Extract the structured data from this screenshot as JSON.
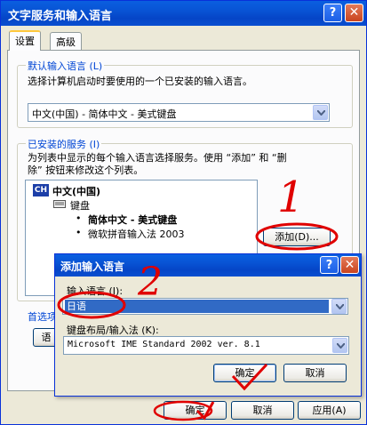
{
  "window": {
    "title": "文字服务和输入语言",
    "help_glyph": "?",
    "close_glyph": "✕"
  },
  "tabs": [
    {
      "label": "设置",
      "active": true
    },
    {
      "label": "高级",
      "active": false
    }
  ],
  "default_language": {
    "group_label": "默认输入语言 (L)",
    "description": "选择计算机启动时要使用的一个已安装的输入语言。",
    "selected": "中文(中国) - 简体中文 - 美式键盘"
  },
  "installed_services": {
    "group_label": "已安装的服务 (I)",
    "description_line1": "为列表中显示的每个输入语言选择服务。使用 “添加” 和 “删",
    "description_line2": "除” 按钮来修改这个列表。",
    "tree": {
      "lang_badge": "CH",
      "language": "中文(中国)",
      "category": "键盘",
      "items": [
        "简体中文 - 美式键盘",
        "微软拼音输入法 2003"
      ]
    },
    "add_button": "添加(D)..."
  },
  "preferences": {
    "group_label": "首选项",
    "button_partial": "语"
  },
  "dialog": {
    "title": "添加输入语言",
    "input_language_label": "输入语言 (I):",
    "input_language_value": "日语",
    "keyboard_label": "键盘布局/输入法 (K):",
    "keyboard_value": "Microsoft IME Standard 2002 ver. 8.1",
    "ok": "确定",
    "cancel": "取消"
  },
  "footer": {
    "ok": "确定",
    "cancel": "取消",
    "apply": "应用(A)"
  },
  "annotations": {
    "num1": "1",
    "num2": "2",
    "color": "#e00000"
  }
}
